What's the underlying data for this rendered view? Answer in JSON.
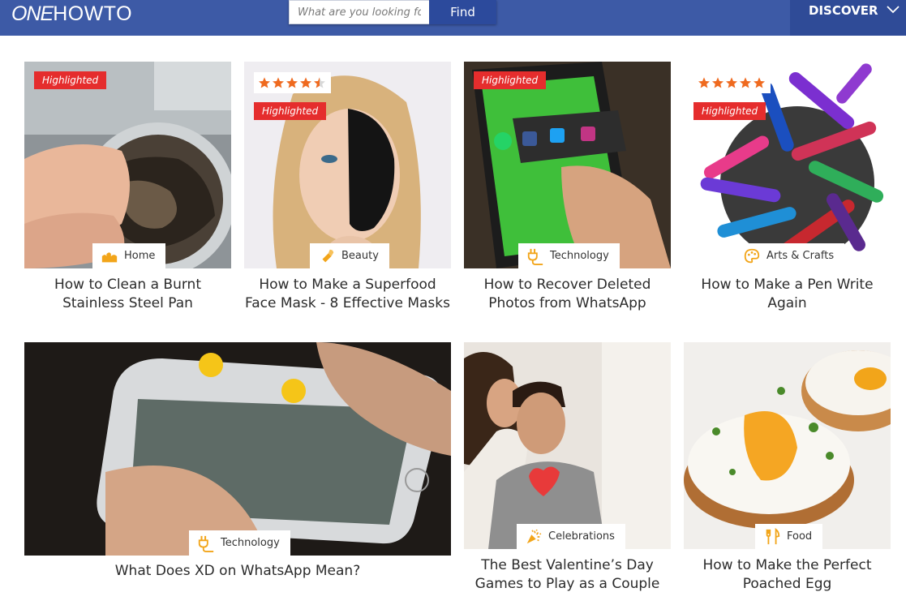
{
  "header": {
    "logo_one": "ONE",
    "logo_howto": "HOWTO",
    "search_placeholder": "What are you looking for?",
    "find_label": "Find",
    "discover_label": "DISCOVER"
  },
  "colors": {
    "header_bg": "#3d5aa6",
    "discover_bg": "#2f4b97",
    "highlight_red": "#e52d2d",
    "star_orange": "#ef6a1f",
    "category_icon": "#f2a51a"
  },
  "cards": [
    {
      "title": "How to Clean a Burnt Stainless Steel Pan",
      "category": "Home",
      "category_icon": "home-icon",
      "highlighted": "Highlighted"
    },
    {
      "title": "How to Make a Superfood Face Mask - 8 Effective Masks",
      "category": "Beauty",
      "category_icon": "lipstick-icon",
      "highlighted": "Highlighted",
      "rating": 4.5
    },
    {
      "title": "How to Recover Deleted Photos from WhatsApp",
      "category": "Technology",
      "category_icon": "plug-icon",
      "highlighted": "Highlighted"
    },
    {
      "title": "How to Make a Pen Write Again",
      "category": "Arts & Crafts",
      "category_icon": "palette-icon",
      "highlighted": "Highlighted",
      "rating": 5
    },
    {
      "title": "What Does XD on WhatsApp Mean?",
      "category": "Technology",
      "category_icon": "plug-icon"
    },
    {
      "title": "The Best Valentine’s Day Games to Play as a Couple",
      "category": "Celebrations",
      "category_icon": "party-popper-icon"
    },
    {
      "title": "How to Make the Perfect Poached Egg",
      "category": "Food",
      "category_icon": "utensils-icon"
    }
  ]
}
